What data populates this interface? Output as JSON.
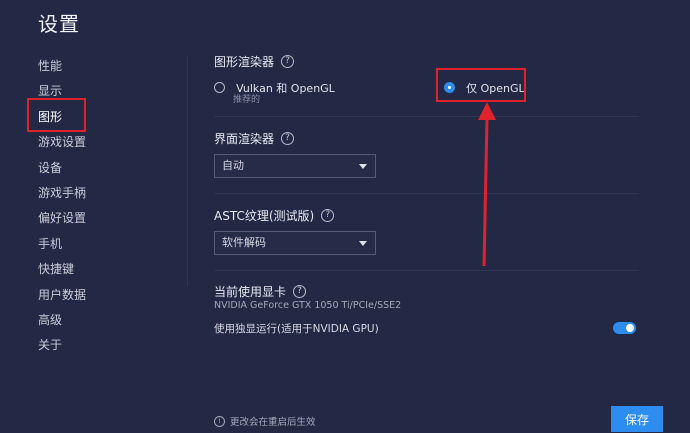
{
  "page": {
    "title": "设置"
  },
  "sidebar": {
    "items": [
      {
        "label": "性能"
      },
      {
        "label": "显示"
      },
      {
        "label": "图形"
      },
      {
        "label": "游戏设置"
      },
      {
        "label": "设备"
      },
      {
        "label": "游戏手柄"
      },
      {
        "label": "偏好设置"
      },
      {
        "label": "手机"
      },
      {
        "label": "快捷键"
      },
      {
        "label": "用户数据"
      },
      {
        "label": "高级"
      },
      {
        "label": "关于"
      }
    ],
    "active": "图形"
  },
  "graphics_renderer": {
    "label": "图形渲染器",
    "options": [
      {
        "label": "Vulkan 和 OpenGL",
        "sublabel": "推荐的",
        "selected": false
      },
      {
        "label": "仅 OpenGL",
        "selected": true
      }
    ]
  },
  "ui_renderer": {
    "label": "界面渲染器",
    "value": "自动"
  },
  "astc": {
    "label": "ASTC纹理(测试版)",
    "value": "软件解码"
  },
  "gpu": {
    "label": "当前使用显卡",
    "info": "NVIDIA GeForce GTX 1050 Ti/PCIe/SSE2",
    "dedicated_label": "使用独显运行(适用于NVIDIA GPU)",
    "dedicated_enabled": true
  },
  "footer": {
    "note": "更改会在重启后生效",
    "save_label": "保存"
  },
  "help_glyph": "?",
  "info_glyph": "i",
  "annotation_color": "#e0222d",
  "accent_color": "#2d8cf0"
}
